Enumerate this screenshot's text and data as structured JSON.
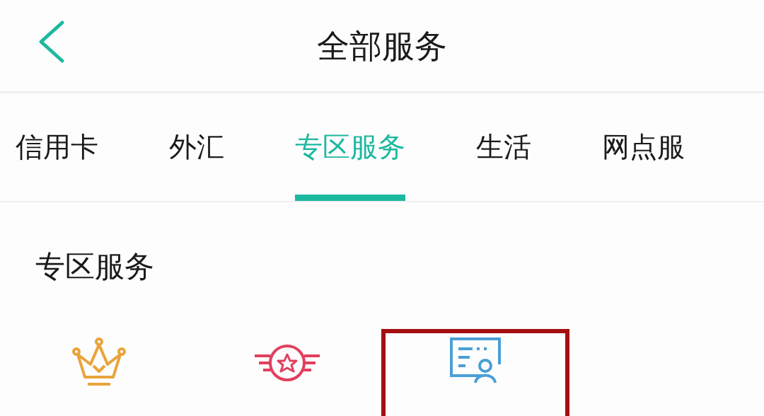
{
  "header": {
    "title": "全部服务"
  },
  "tabs": [
    {
      "label": "信用卡",
      "selected": false
    },
    {
      "label": "外汇",
      "selected": false
    },
    {
      "label": "专区服务",
      "selected": true
    },
    {
      "label": "生活",
      "selected": false
    },
    {
      "label": "网点服",
      "selected": false
    }
  ],
  "section": {
    "title": "专区服务",
    "items": [
      {
        "kind": "crown",
        "highlighted": false
      },
      {
        "kind": "badge",
        "highlighted": false
      },
      {
        "kind": "certificate",
        "highlighted": true
      }
    ]
  }
}
